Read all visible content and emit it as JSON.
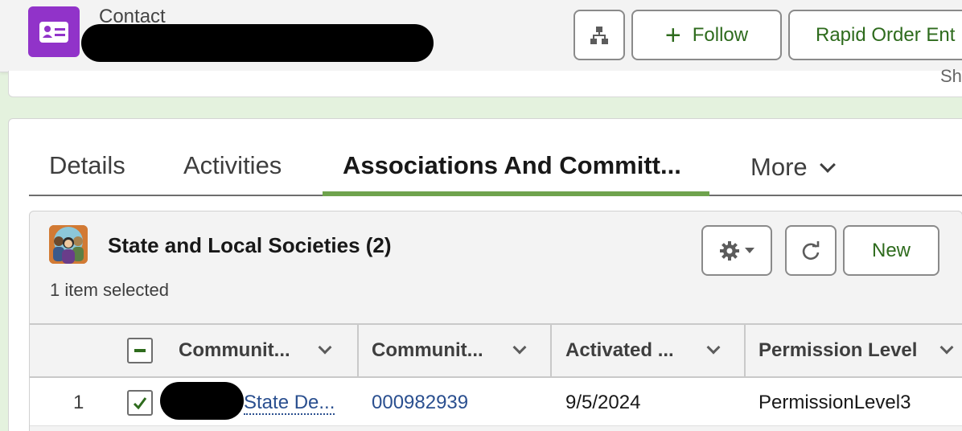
{
  "header": {
    "object_type": "Contact",
    "icon": "contact-card-icon",
    "buttons": {
      "hierarchy_icon": "hierarchy-icon",
      "follow_label": "Follow",
      "rapid_order_label": "Rapid Order Ent"
    },
    "highlights_partial_text": "Sh"
  },
  "tabs": [
    {
      "label": "Details"
    },
    {
      "label": "Activities"
    },
    {
      "label": "Associations And Committ..."
    },
    {
      "label": "More"
    }
  ],
  "active_tab": "Associations And Committ...",
  "related_list": {
    "icon": "people-group-icon",
    "title": "State and Local Societies (2)",
    "selection_text": "1 item selected",
    "new_label": "New",
    "columns": [
      "Communit...",
      "Communit...",
      "Activated ...",
      "Permission Level"
    ],
    "rows": [
      {
        "row_number": "1",
        "selected": true,
        "community_name": "State De...",
        "community_number": "000982939",
        "activated": "9/5/2024",
        "permission_level": "PermissionLevel3"
      }
    ]
  },
  "colors": {
    "background": "#e4f2de",
    "brand_purple": "#9133c9",
    "accent_green": "#6fa34d",
    "button_text": "#2e6b1d",
    "link": "#2a4f8f"
  }
}
